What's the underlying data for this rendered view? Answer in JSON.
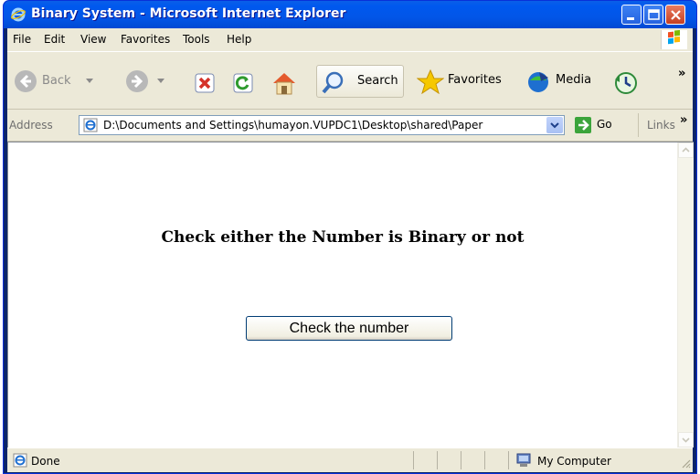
{
  "window": {
    "title": "Binary System - Microsoft Internet Explorer"
  },
  "menu": {
    "items": [
      "File",
      "Edit",
      "View",
      "Favorites",
      "Tools",
      "Help"
    ]
  },
  "toolbar": {
    "back_label": "Back",
    "search_label": "Search",
    "favorites_label": "Favorites",
    "media_label": "Media",
    "more": "»"
  },
  "address": {
    "label": "Address",
    "value": "D:\\Documents and Settings\\humayon.VUPDC1\\Desktop\\shared\\Paper",
    "go_label": "Go",
    "links_label": "Links",
    "more": "»"
  },
  "page": {
    "heading": "Check either the Number is Binary or not",
    "button_label": "Check the number"
  },
  "status": {
    "text": "Done",
    "zone": "My Computer"
  }
}
